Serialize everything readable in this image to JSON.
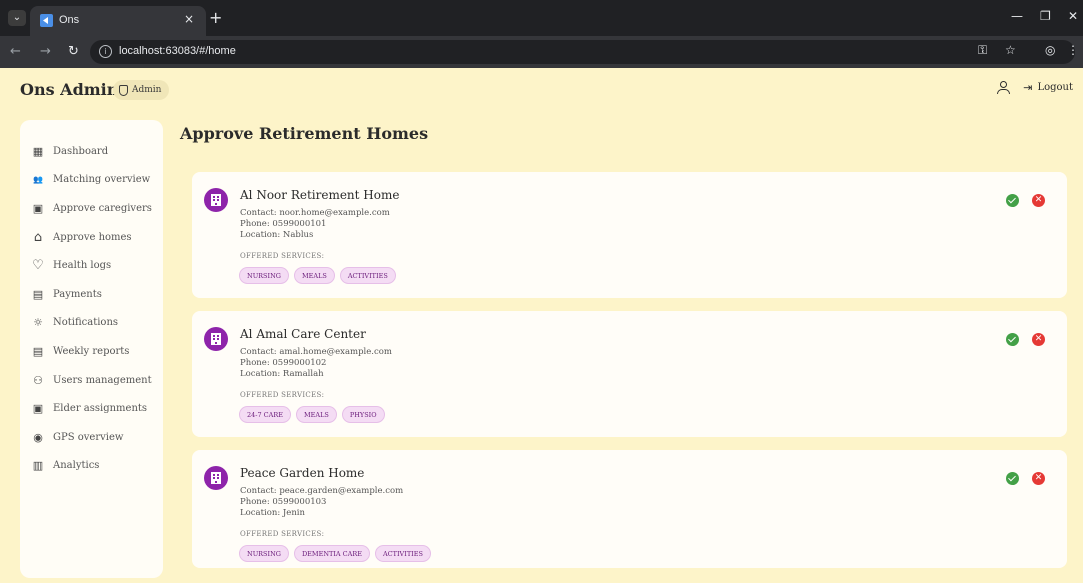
{
  "browser": {
    "tab_title": "Ons",
    "url": "localhost:63083/#/home",
    "new_tab": "+",
    "tab_close": "×",
    "tab_menu": "⌄"
  },
  "header": {
    "app_title": "Ons Admin",
    "role_chip": "Admin",
    "logout_label": "Logout"
  },
  "sidebar": {
    "items": [
      {
        "label": "Dashboard",
        "icon": "dashboard-icon",
        "glyph": "▦"
      },
      {
        "label": "Matching overview",
        "icon": "groups-icon",
        "glyph": "👥"
      },
      {
        "label": "Approve caregivers",
        "icon": "badge-icon",
        "glyph": "▣"
      },
      {
        "label": "Approve homes",
        "icon": "home-icon",
        "glyph": "⌂"
      },
      {
        "label": "Health logs",
        "icon": "heart-icon",
        "glyph": "♡"
      },
      {
        "label": "Payments",
        "icon": "payments-icon",
        "glyph": "▤"
      },
      {
        "label": "Notifications",
        "icon": "bell-icon",
        "glyph": "☼"
      },
      {
        "label": "Weekly reports",
        "icon": "report-icon",
        "glyph": "▤"
      },
      {
        "label": "Users management",
        "icon": "users-icon",
        "glyph": "⚇"
      },
      {
        "label": "Elder assignments",
        "icon": "assignment-icon",
        "glyph": "▣"
      },
      {
        "label": "GPS overview",
        "icon": "location-icon",
        "glyph": "◉"
      },
      {
        "label": "Analytics",
        "icon": "analytics-icon",
        "glyph": "▥"
      }
    ]
  },
  "main": {
    "title": "Approve Retirement Homes",
    "services_label": "OFFERED SERVICES:",
    "homes": [
      {
        "name": "Al Noor Retirement Home",
        "contact": "Contact: noor.home@example.com",
        "phone": "Phone: 0599000101",
        "location": "Location: Nablus",
        "services": [
          "NURSING",
          "MEALS",
          "ACTIVITIES"
        ]
      },
      {
        "name": "Al Amal Care Center",
        "contact": "Contact: amal.home@example.com",
        "phone": "Phone: 0599000102",
        "location": "Location: Ramallah",
        "services": [
          "24-7 CARE",
          "MEALS",
          "PHYSIO"
        ]
      },
      {
        "name": "Peace Garden Home",
        "contact": "Contact: peace.garden@example.com",
        "phone": "Phone: 0599000103",
        "location": "Location: Jenin",
        "services": [
          "NURSING",
          "DEMENTIA CARE",
          "ACTIVITIES"
        ]
      }
    ]
  },
  "colors": {
    "background": "#fdf4c9",
    "card": "#fffdf8",
    "avatar": "#8e24aa",
    "approve": "#43a047",
    "reject": "#e53935",
    "chip": "#f4dcf4"
  }
}
